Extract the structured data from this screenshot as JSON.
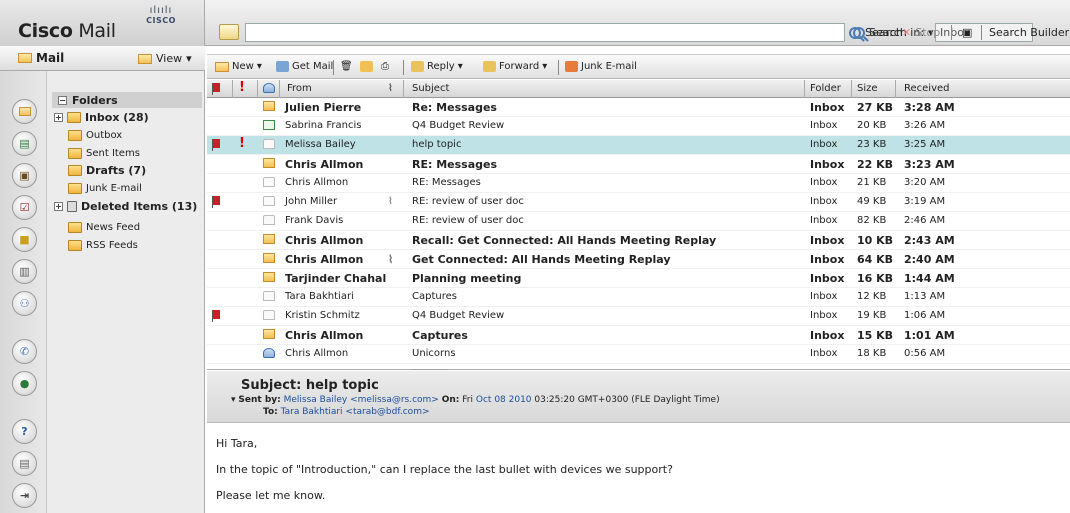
{
  "app": {
    "brand_bold": "Cisco",
    "brand_rest": " Mail",
    "logo_bars": "ılıılı",
    "logo_word": "CISCO"
  },
  "search": {
    "placeholder": "",
    "search_in_label": "Search in:",
    "scope": "Inbox",
    "search_label": "Search",
    "stop_label": "Stop",
    "builder_label": "Search Builder"
  },
  "sidebar": {
    "mail_label": "Mail",
    "view_label": "View",
    "folders_label": "Folders",
    "folders": [
      {
        "label": "Inbox (28)",
        "bold": true
      },
      {
        "label": "Outbox",
        "bold": false
      },
      {
        "label": "Sent Items",
        "bold": false
      },
      {
        "label": "Drafts (7)",
        "bold": true
      },
      {
        "label": "Junk E-mail",
        "bold": false
      },
      {
        "label": "Deleted Items (13)",
        "bold": true
      },
      {
        "label": "News Feed",
        "bold": false
      },
      {
        "label": "RSS Feeds",
        "bold": false
      }
    ]
  },
  "toolbar": {
    "new": "New",
    "get_mail": "Get Mail",
    "reply": "Reply",
    "forward": "Forward",
    "junk": "Junk E-mail"
  },
  "columns": {
    "from": "From",
    "subject": "Subject",
    "folder": "Folder",
    "size": "Size",
    "received": "Received"
  },
  "messages": [
    {
      "from": "Julien Pierre",
      "subject": "Re: Messages",
      "folder": "Inbox",
      "size": "27 KB",
      "received": "3:28 AM",
      "unread": true,
      "status": "unread",
      "flag": false,
      "important": false,
      "attach": false,
      "selected": false
    },
    {
      "from": "Sabrina Francis",
      "subject": "Q4 Budget Review",
      "folder": "Inbox",
      "size": "20 KB",
      "received": "3:26 AM",
      "unread": false,
      "status": "cal",
      "flag": false,
      "important": false,
      "attach": false,
      "selected": false
    },
    {
      "from": "Melissa Bailey",
      "subject": "help topic",
      "folder": "Inbox",
      "size": "23 KB",
      "received": "3:25 AM",
      "unread": false,
      "status": "read",
      "flag": true,
      "important": true,
      "attach": false,
      "selected": true
    },
    {
      "from": "Chris Allmon",
      "subject": "RE: Messages",
      "folder": "Inbox",
      "size": "22 KB",
      "received": "3:23 AM",
      "unread": true,
      "status": "unread",
      "flag": false,
      "important": false,
      "attach": false,
      "selected": false
    },
    {
      "from": "Chris Allmon",
      "subject": "RE: Messages",
      "folder": "Inbox",
      "size": "21 KB",
      "received": "3:20 AM",
      "unread": false,
      "status": "read",
      "flag": false,
      "important": false,
      "attach": false,
      "selected": false
    },
    {
      "from": "John Miller",
      "subject": "RE: review of user doc",
      "folder": "Inbox",
      "size": "49 KB",
      "received": "3:19 AM",
      "unread": false,
      "status": "read",
      "flag": true,
      "important": false,
      "attach": true,
      "selected": false
    },
    {
      "from": "Frank Davis",
      "subject": "RE: review of user doc",
      "folder": "Inbox",
      "size": "82 KB",
      "received": "2:46 AM",
      "unread": false,
      "status": "read",
      "flag": false,
      "important": false,
      "attach": false,
      "selected": false
    },
    {
      "from": "Chris Allmon",
      "subject": "Recall: Get Connected: All Hands Meeting Replay",
      "folder": "Inbox",
      "size": "10 KB",
      "received": "2:43 AM",
      "unread": true,
      "status": "unread",
      "flag": false,
      "important": false,
      "attach": false,
      "selected": false
    },
    {
      "from": "Chris Allmon",
      "subject": "Get Connected: All Hands Meeting Replay",
      "folder": "Inbox",
      "size": "64 KB",
      "received": "2:40 AM",
      "unread": true,
      "status": "unread",
      "flag": false,
      "important": false,
      "attach": true,
      "selected": false
    },
    {
      "from": "Tarjinder Chahal",
      "subject": "Planning meeting",
      "folder": "Inbox",
      "size": "16 KB",
      "received": "1:44 AM",
      "unread": true,
      "status": "unread",
      "flag": false,
      "important": false,
      "attach": false,
      "selected": false
    },
    {
      "from": "Tara Bakhtiari",
      "subject": "Captures",
      "folder": "Inbox",
      "size": "12 KB",
      "received": "1:13 AM",
      "unread": false,
      "status": "read",
      "flag": false,
      "important": false,
      "attach": false,
      "selected": false
    },
    {
      "from": "Kristin Schmitz",
      "subject": "Q4 Budget Review",
      "folder": "Inbox",
      "size": "19 KB",
      "received": "1:06 AM",
      "unread": false,
      "status": "read",
      "flag": true,
      "important": false,
      "attach": false,
      "selected": false
    },
    {
      "from": "Chris Allmon",
      "subject": "Captures",
      "folder": "Inbox",
      "size": "15 KB",
      "received": "1:01 AM",
      "unread": true,
      "status": "unread",
      "flag": false,
      "important": false,
      "attach": false,
      "selected": false
    },
    {
      "from": "Chris Allmon",
      "subject": "Unicorns",
      "folder": "Inbox",
      "size": "18 KB",
      "received": "0:56 AM",
      "unread": false,
      "status": "user",
      "flag": false,
      "important": false,
      "attach": false,
      "selected": false
    }
  ],
  "preview": {
    "subject_label": "Subject:",
    "subject": "help topic",
    "sent_by_label": "Sent by:",
    "sender": "Melissa Bailey <melissa@rs.com>",
    "on_label": "On:",
    "date_prefix": "Fri",
    "date_link": "Oct 08 2010",
    "date_rest": "03:25:20 GMT+0300 (FLE Daylight Time)",
    "to_label": "To:",
    "recipient": "Tara Bakhtiari <tarab@bdf.com>",
    "body": [
      "Hi Tara,",
      "In the topic of \"Introduction,\" can I replace the last bullet with devices we support?",
      "Please let me know."
    ]
  },
  "colors": {
    "selected_row": "#bfe2e6",
    "flag": "#c8202a",
    "link": "#1a4d9a"
  }
}
